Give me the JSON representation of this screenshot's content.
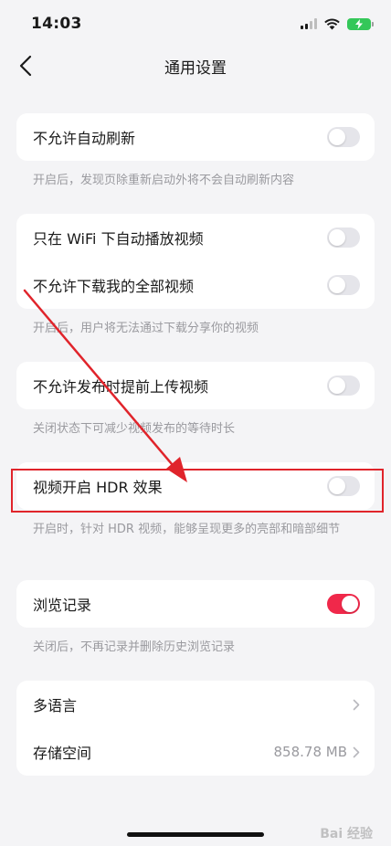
{
  "status_bar": {
    "time": "14:03"
  },
  "nav": {
    "title": "通用设置"
  },
  "sections": {
    "auto_refresh": {
      "label": "不允许自动刷新",
      "hint": "开启后，发现页除重新启动外将不会自动刷新内容",
      "enabled": false
    },
    "wifi_autoplay": {
      "label": "只在 WiFi 下自动播放视频",
      "enabled": false
    },
    "no_download": {
      "label": "不允许下载我的全部视频",
      "hint": "开启后，用户将无法通过下载分享你的视频",
      "enabled": false
    },
    "pre_upload": {
      "label": "不允许发布时提前上传视频",
      "hint": "关闭状态下可减少视频发布的等待时长",
      "enabled": false
    },
    "hdr": {
      "label": "视频开启 HDR 效果",
      "hint": "开启时，针对 HDR 视频，能够呈现更多的亮部和暗部细节",
      "enabled": false
    },
    "history": {
      "label": "浏览记录",
      "hint": "关闭后，不再记录并删除历史浏览记录",
      "enabled": true
    },
    "language": {
      "label": "多语言"
    },
    "storage": {
      "label": "存储空间",
      "value": "858.78 MB"
    }
  },
  "watermark": "Bai 经验",
  "colors": {
    "accent": "#f0284a",
    "annotation": "#e0242b",
    "battery": "#34c759"
  }
}
